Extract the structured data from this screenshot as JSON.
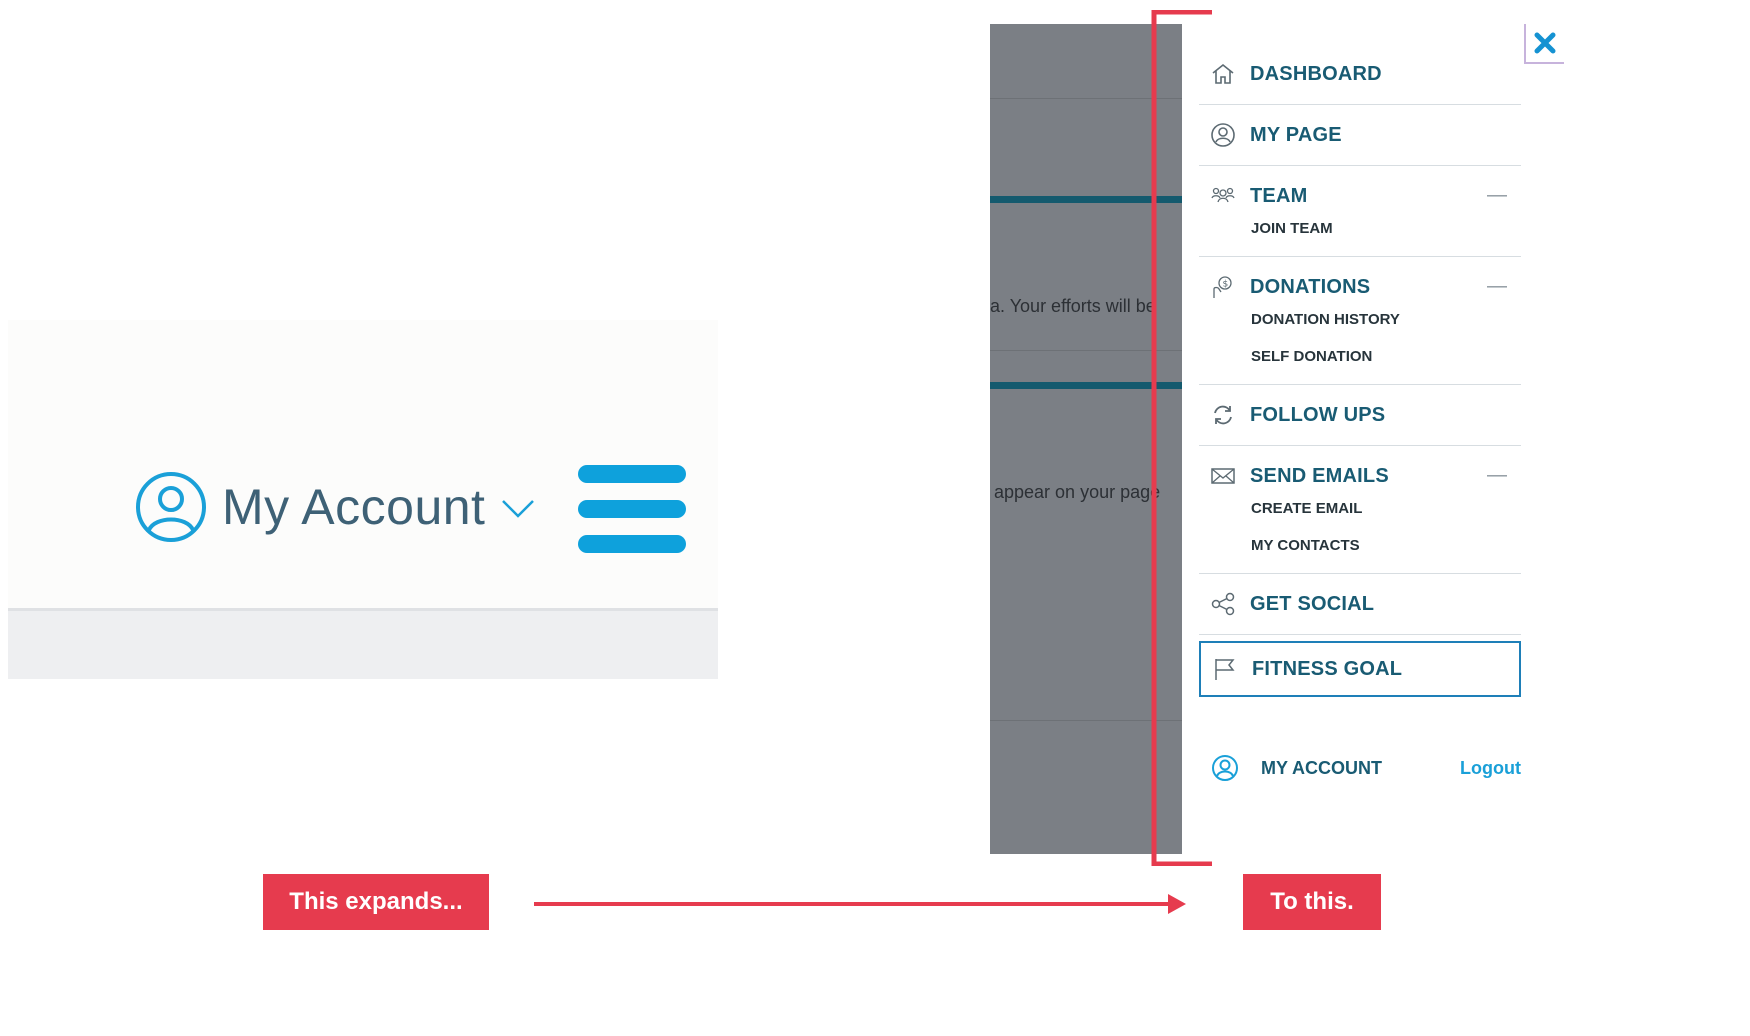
{
  "left": {
    "account_label": "My Account"
  },
  "overlay": {
    "text1": "a. Your efforts will be",
    "text2": "appear on your page"
  },
  "menu": {
    "items": [
      {
        "label": "DASHBOARD",
        "icon": "home-icon"
      },
      {
        "label": "MY PAGE",
        "icon": "user-circle-icon"
      },
      {
        "label": "TEAM",
        "icon": "team-icon",
        "toggle": "—",
        "sub": [
          "JOIN TEAM"
        ]
      },
      {
        "label": "DONATIONS",
        "icon": "donation-hand-icon",
        "toggle": "—",
        "sub": [
          "DONATION HISTORY",
          "SELF DONATION"
        ]
      },
      {
        "label": "FOLLOW UPS",
        "icon": "refresh-icon"
      },
      {
        "label": "SEND EMAILS",
        "icon": "envelope-icon",
        "toggle": "—",
        "sub": [
          "CREATE EMAIL",
          "MY CONTACTS"
        ]
      },
      {
        "label": "GET SOCIAL",
        "icon": "share-icon"
      },
      {
        "label": "FITNESS GOAL",
        "icon": "flag-icon"
      }
    ],
    "account_label": "MY ACCOUNT",
    "logout_label": "Logout"
  },
  "annotations": {
    "left_callout": "This expands...",
    "right_callout": "To this."
  },
  "colors": {
    "accent_blue": "#0ea1dc",
    "menu_text": "#195b73",
    "annotation_red": "#e63b4e",
    "overlay_gray": "#7b7f85"
  }
}
